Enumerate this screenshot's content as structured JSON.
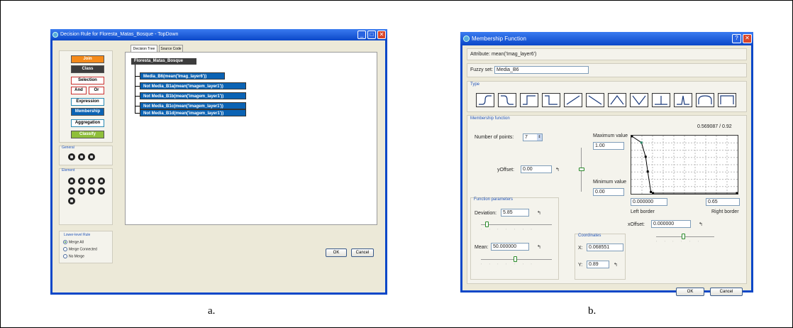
{
  "captions": {
    "a": "a.",
    "b": "b."
  },
  "windowA": {
    "title": "Decision Rule for Floresta_Matas_Bosque - TopDown",
    "controls": {
      "minimize": "_",
      "maximize": "□",
      "close": "✕"
    },
    "class_buttons": [
      {
        "label": "Join",
        "bg": "#f58a1a",
        "fg": "#ffffff"
      },
      {
        "label": "Class",
        "bg": "#3d3d3d",
        "fg": "#ffffff"
      },
      {
        "label": "Selection",
        "bg": "#ffffff",
        "fg": "#000000"
      },
      {
        "label": "And",
        "bg": "#ffffff",
        "fg": "#000000"
      },
      {
        "label": "Or",
        "bg": "#ffffff",
        "fg": "#000000"
      },
      {
        "label": "Expression",
        "bg": "#ffffff",
        "fg": "#000000"
      },
      {
        "label": "Membership",
        "bg": "#0b63b4",
        "fg": "#ffffff"
      },
      {
        "label": "Aggregation",
        "bg": "#ffffff",
        "fg": "#000000"
      },
      {
        "label": "Classify",
        "bg": "#8fbf3a",
        "fg": "#ffffff"
      }
    ],
    "general_label": "General",
    "element_label": "Element",
    "tabs": [
      "Decision Tree",
      "Source Code"
    ],
    "tree": {
      "root": "Floresta_Matas_Bosque",
      "nodes": [
        "Media_B6(mean('Imag_layer6'))",
        "Not Media_B1a(mean('imagem_layer1'))",
        "Not Media_B1b(mean('imagem_layer1'))",
        "Not Media_B1c(mean('imagem_layer1'))",
        "Not Media_B1d(mean('imagem_layer1'))"
      ]
    },
    "lower_level_rule": {
      "label": "Lower-level Rule",
      "options": [
        "Merge All",
        "Merge Connected",
        "No Merge"
      ],
      "selected": "Merge All"
    },
    "ok": "OK",
    "cancel": "Cancel"
  },
  "windowB": {
    "title": "Membership Function",
    "controls": {
      "help": "?",
      "close": "✕"
    },
    "attribute": "Attribute: mean('Imag_layer6')",
    "fuzzy_set_label": "Fuzzy set:",
    "fuzzy_set_value": "Media_B6",
    "type_label": "Type",
    "membership_label": "Membership function",
    "readout": "0.569087  /  0.92",
    "num_points_label": "Number of points:",
    "num_points_value": "7",
    "max_value_label": "Maximum value",
    "max_value": "1.00",
    "min_value_label": "Minimum value",
    "min_value": "0.00",
    "yoffset_label": "yOffset:",
    "yoffset_value": "0.00",
    "function_params_label": "Function parameters",
    "deviation_label": "Deviation:",
    "deviation_value": "5.85",
    "mean_label": "Mean:",
    "mean_value": "50.000000",
    "left_border_value": "0.000000",
    "left_border_label": "Left border",
    "right_border_value": "0.65",
    "right_border_label": "Right border",
    "coordinates_label": "Coordinates",
    "x_label": "X:",
    "x_value": "0.068551",
    "y_label": "Y:",
    "y_value": "0.89",
    "xoffset_label": "xOffset:",
    "xoffset_value": "0.000000",
    "ok": "OK",
    "cancel": "Cancel",
    "curve_points": [
      [
        0.0,
        1.0
      ],
      [
        0.09,
        0.89
      ],
      [
        0.13,
        0.64
      ],
      [
        0.15,
        0.38
      ],
      [
        0.18,
        0.02
      ],
      [
        0.2,
        0.0
      ],
      [
        1.0,
        0.0
      ]
    ]
  }
}
